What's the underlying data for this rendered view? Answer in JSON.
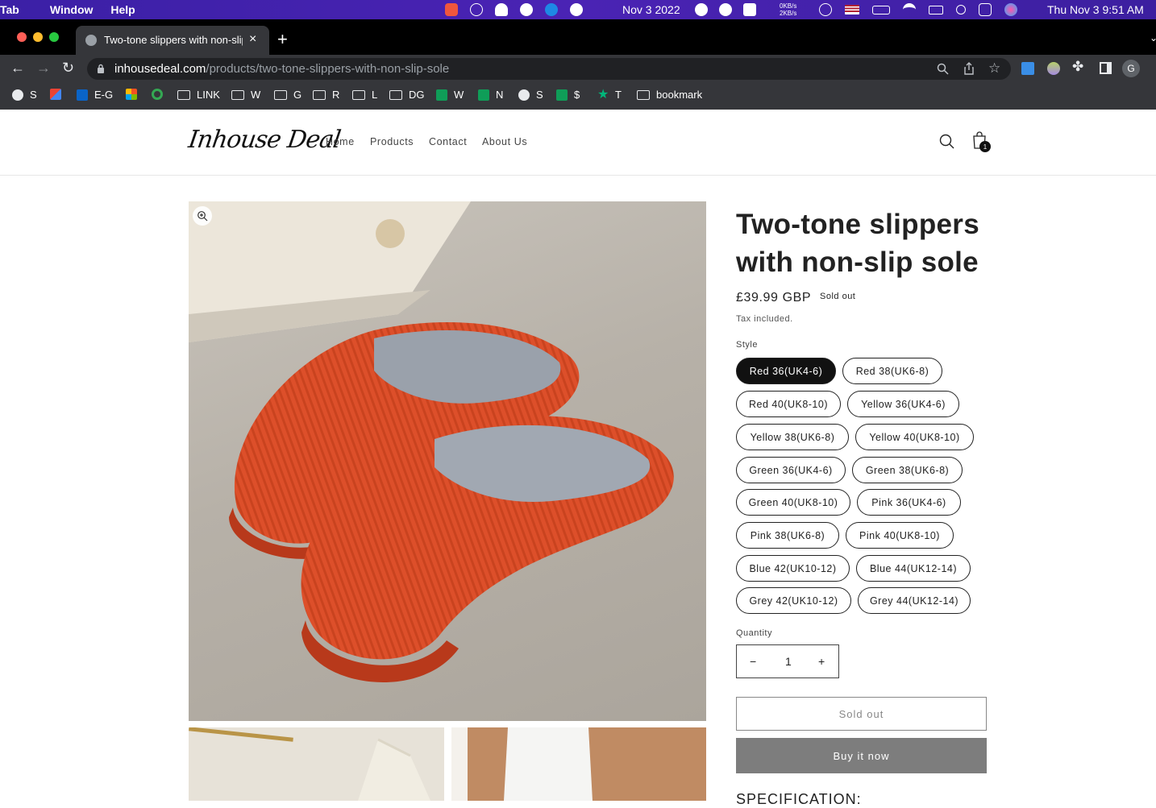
{
  "menubar": {
    "app_fragment": "Tab",
    "menus": [
      "Window",
      "Help"
    ],
    "date_center": "Nov 3 2022",
    "net_up": "0KB/s",
    "net_down": "2KB/s",
    "clock": "Thu Nov 3  9:51 AM"
  },
  "browser": {
    "tab_title": "Two-tone slippers with non-slip sole",
    "url_host": "inhousedeal.com",
    "url_path": "/products/two-tone-slippers-with-non-slip-sole",
    "profile_initial": "G",
    "bookmarks": [
      "S",
      "",
      "E-G",
      "",
      "",
      "LINK",
      "W",
      "G",
      "R",
      "L",
      "DG",
      "W",
      "N",
      "S",
      "$",
      "T",
      "bookmark"
    ]
  },
  "site": {
    "logo": "Inhouse Deal",
    "nav": [
      "Home",
      "Products",
      "Contact",
      "About Us"
    ],
    "cart_count": "1"
  },
  "product": {
    "title": "Two-tone slippers with non-slip sole",
    "price": "£39.99 GBP",
    "sold_badge": "Sold out",
    "tax_note": "Tax included.",
    "style_label": "Style",
    "styles": [
      "Red 36(UK4-6)",
      "Red 38(UK6-8)",
      "Red 40(UK8-10)",
      "Yellow 36(UK4-6)",
      "Yellow 38(UK6-8)",
      "Yellow 40(UK8-10)",
      "Green 36(UK4-6)",
      "Green 38(UK6-8)",
      "Green 40(UK8-10)",
      "Pink 36(UK4-6)",
      "Pink 38(UK6-8)",
      "Pink 40(UK8-10)",
      "Blue 42(UK10-12)",
      "Blue 44(UK12-14)",
      "Grey 42(UK10-12)",
      "Grey 44(UK12-14)"
    ],
    "selected_style": "Red 36(UK4-6)",
    "quantity_label": "Quantity",
    "quantity": "1",
    "minus": "−",
    "plus": "+",
    "soldout_button": "Sold out",
    "buy_button": "Buy it now",
    "spec_heading": "SPECIFICATION:"
  }
}
